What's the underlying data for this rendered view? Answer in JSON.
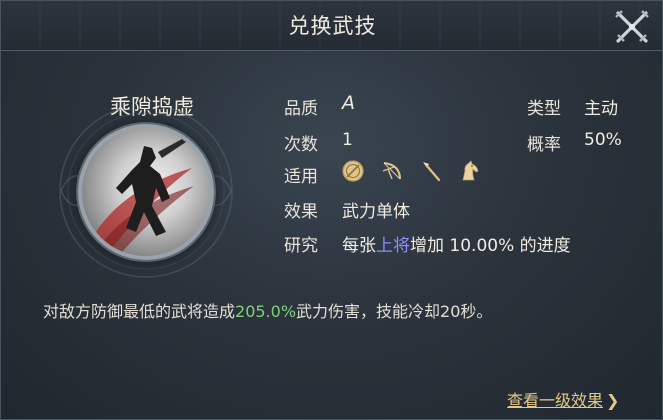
{
  "dialog": {
    "title": "兑换武技",
    "close_icon": "crossed-swords-close-icon"
  },
  "skill": {
    "name": "乘隙捣虚",
    "icon": "warrior-slash-icon"
  },
  "props": {
    "quality_label": "品质",
    "quality_value": "A",
    "type_label": "类型",
    "type_value": "主动",
    "count_label": "次数",
    "count_value": "1",
    "rate_label": "概率",
    "rate_value": "50%",
    "applicable_label": "适用",
    "applicable_icons": [
      "shield-icon",
      "bow-icon",
      "spear-icon",
      "horse-icon"
    ],
    "effect_label": "效果",
    "effect_value": "武力单体",
    "research_label": "研究",
    "research_prefix": "每张",
    "research_highlight": "上将",
    "research_suffix": "增加 10.00% 的进度"
  },
  "description": {
    "prefix": "对敌方防御最低的武将造成",
    "highlight": "205.0%",
    "suffix": "武力伤害，技能冷却20秒。"
  },
  "footer": {
    "link_label": "查看一级效果",
    "link_arrow": "❯"
  },
  "colors": {
    "accent_blue": "#8f8cff",
    "accent_green": "#7fd27a",
    "link_gold": "#e4c88a"
  }
}
